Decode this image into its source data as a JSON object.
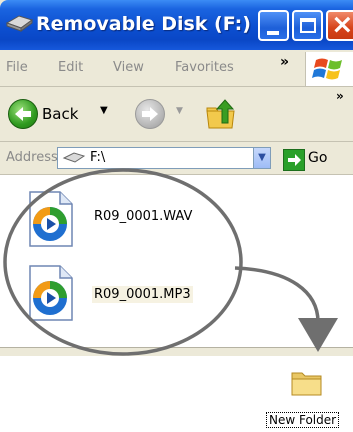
{
  "window": {
    "title": "Removable Disk (F:)",
    "buttons": {
      "minimize": "",
      "maximize": "",
      "close": "×"
    }
  },
  "menu": {
    "items": [
      "File",
      "Edit",
      "View",
      "Favorites"
    ],
    "overflow": "»"
  },
  "toolbar": {
    "back_label": "Back",
    "back_dropdown": "▼",
    "forward_dropdown": "▼",
    "overflow": "»"
  },
  "address": {
    "label": "Address",
    "value": "F:\\",
    "dropdown": "▼",
    "go_label": "Go"
  },
  "files": [
    {
      "name": "R09_0001.WAV"
    },
    {
      "name": "R09_0001.MP3"
    }
  ],
  "desktop": {
    "folder_label": "New Folder"
  },
  "colors": {
    "titlebar": "#0a47c6",
    "window_face": "#ece9d8",
    "annotation_stroke": "#6f6f6f"
  }
}
